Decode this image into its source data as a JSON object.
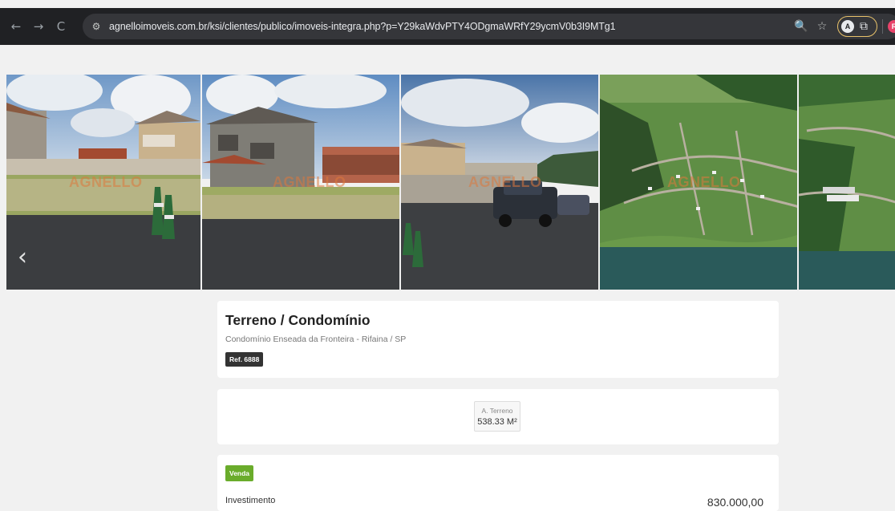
{
  "browser": {
    "back_icon": "←",
    "forward_icon": "→",
    "reload_icon": "C",
    "site_settings_icon": "⚙",
    "url_domain": "agnelloimoveis.com.br",
    "url_path": "/ksi/clientes/publico/imoveis-integra.php?p=Y29kaWdvPTY4ODgmaWRfY29ycmV0b3I9MTg1",
    "zoom_icon": "🔍",
    "star_icon": "☆",
    "extension_letter": "A",
    "profile_letter": "R"
  },
  "gallery": {
    "prev_arrow": "‹",
    "watermark_text": "AGNELLO",
    "photos": [
      {
        "label": "street-houses-1"
      },
      {
        "label": "house-front"
      },
      {
        "label": "street-truck"
      },
      {
        "label": "aerial-condo-1"
      },
      {
        "label": "aerial-condo-2"
      }
    ]
  },
  "property": {
    "title": "Terreno / Condomínio",
    "location": "Condomínio Enseada da Fronteira - Rifaina / SP",
    "ref": "Ref. 6888"
  },
  "features": {
    "area_label": "A. Terreno",
    "area_value": "538.33 M²"
  },
  "pricing": {
    "badge": "Venda",
    "label": "Investimento",
    "value": "830.000,00"
  },
  "colors": {
    "venda_green": "#6aac2b",
    "ref_dark": "#333333"
  }
}
